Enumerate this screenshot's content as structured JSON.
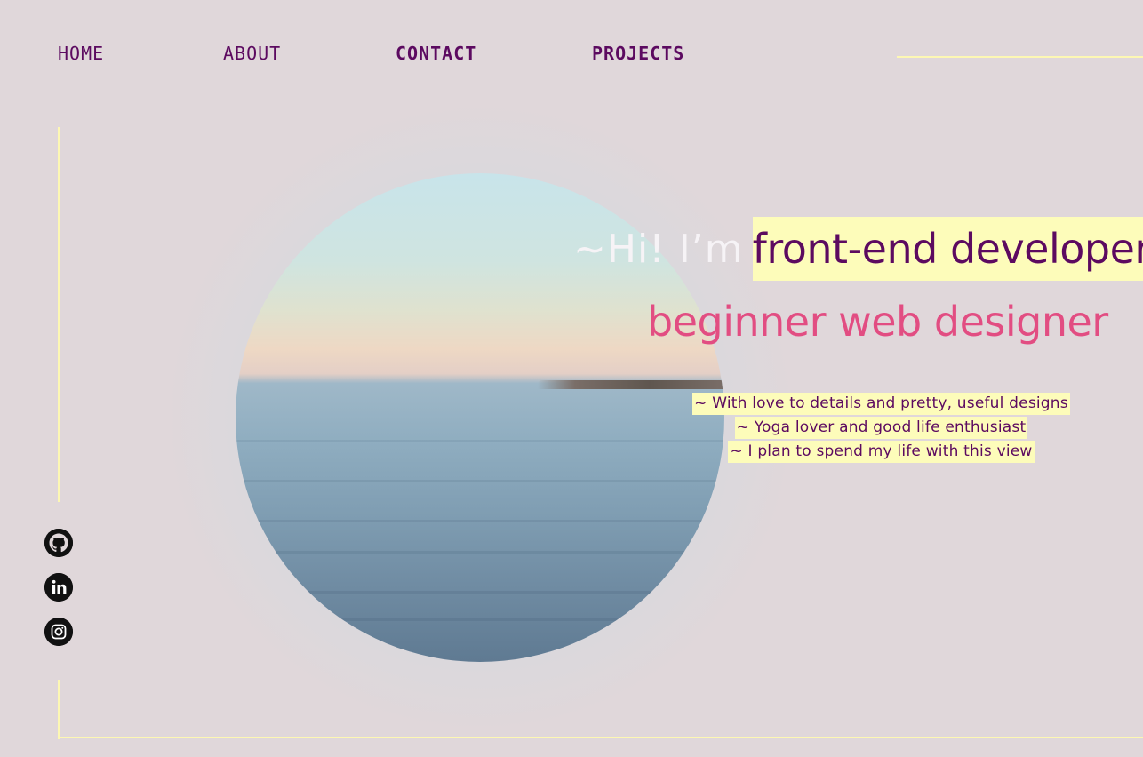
{
  "nav": {
    "home": "HOME",
    "about": "ABOUT",
    "contact": "CONTACT",
    "projects": "PROJECTS"
  },
  "hero": {
    "greeting": "~Hi! I’m",
    "role_primary": "front-end developer",
    "role_secondary": "beginner web designer",
    "taglines": [
      "~ With love to details and pretty, useful designs",
      "~ Yoga lover and good life enthusiast",
      "~ I plan to spend my life with this view"
    ]
  },
  "social": {
    "icons": [
      "github-icon",
      "linkedin-icon",
      "instagram-icon"
    ]
  },
  "colors": {
    "background": "#e0d7da",
    "accent_purple": "#5c0a60",
    "accent_pink": "#e24d82",
    "highlight_yellow": "#fdfcba",
    "line_yellow": "#fdf7b3"
  }
}
